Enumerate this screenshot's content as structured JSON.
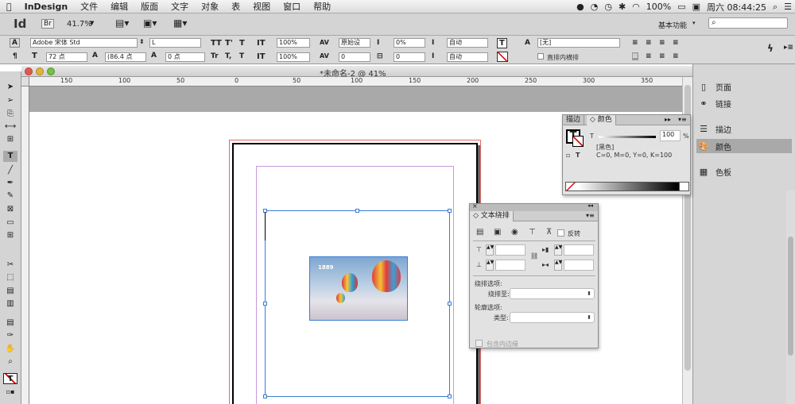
{
  "menubar": {
    "app_name": "InDesign",
    "menus": [
      "文件",
      "编辑",
      "版面",
      "文字",
      "对象",
      "表",
      "视图",
      "窗口",
      "帮助"
    ],
    "battery": "100%",
    "clock": "周六 08:44:25"
  },
  "appbar": {
    "logo": "Id",
    "bridge": "Br",
    "zoom": "41.7%",
    "workspace": "基本功能",
    "search_placeholder": ""
  },
  "control": {
    "font_family": "Adobe 宋体 Std",
    "font_style": "L",
    "font_size": "72 点",
    "leading": "(86.4 点",
    "baseline_shift": "0 点",
    "horiz_scale": "100%",
    "vert_scale": "100%",
    "kerning": "原始设",
    "tracking": "0",
    "tsume": "0%",
    "aki": "0",
    "mojikumi": "自动",
    "mojikumi2": "自动",
    "char_style": "[无]",
    "direct_layout": "直排内横排"
  },
  "document": {
    "title": "*未命名-2 @ 41%",
    "ruler_ticks": [
      "150",
      "100",
      "50",
      "0",
      "50",
      "100",
      "150",
      "200",
      "250",
      "300",
      "350"
    ],
    "image_text": "1889"
  },
  "right_dock": {
    "items": [
      {
        "icon": "pages-icon",
        "label": "页面"
      },
      {
        "icon": "links-icon",
        "label": "链接"
      },
      {
        "icon": "stroke-icon",
        "label": "描边"
      },
      {
        "icon": "color-icon",
        "label": "颜色"
      },
      {
        "icon": "swatches-icon",
        "label": "色板"
      }
    ]
  },
  "color_panel": {
    "tab_stroke": "描边",
    "tab_color": "◇ 颜色",
    "t_label": "T",
    "tint": "100",
    "percent": "%",
    "swatch_name": "[黑色]",
    "cmyk": "C=0, M=0, Y=0, K=100"
  },
  "wrap_panel": {
    "title": "◇ 文本绕排",
    "invert": "反转",
    "wrap_options": "绕排选项:",
    "wrap_to": "绕排至:",
    "contour_options": "轮廓选项:",
    "type": "类型:",
    "include_inside": "包含内边缘"
  }
}
